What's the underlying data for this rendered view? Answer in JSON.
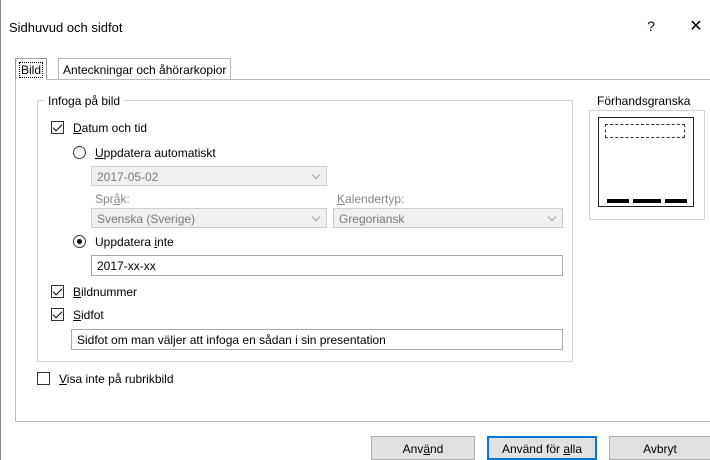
{
  "window": {
    "title": "Sidhuvud och sidfot",
    "help_label": "?",
    "close_label": "✕"
  },
  "tabs": [
    {
      "label": "Bild",
      "active": true
    },
    {
      "label": "Anteckningar och åhörarkopior",
      "active": false
    }
  ],
  "include_group": {
    "legend": "Infoga på bild",
    "date_time": {
      "label_pre": "",
      "label_u": "D",
      "label_post": "atum och tid",
      "checked": true
    },
    "auto_update": {
      "label_u": "U",
      "label_post": "ppdatera automatiskt",
      "selected": false,
      "date_value": "2017-05-02",
      "language_label_pre": "Spr",
      "language_label_u": "å",
      "language_label_post": "k:",
      "language_value": "Svenska (Sverige)",
      "calendar_label_u": "K",
      "calendar_label_post": "alendertyp:",
      "calendar_value": "Gregoriansk"
    },
    "fixed": {
      "label_pre": "Uppdatera ",
      "label_u": "i",
      "label_post": "nte",
      "selected": true,
      "value": "2017-xx-xx"
    },
    "slide_number": {
      "label_u": "B",
      "label_post": "ildnummer",
      "checked": true
    },
    "footer": {
      "label_u": "S",
      "label_post": "idfot",
      "checked": true,
      "value": "Sidfot om man väljer att infoga en sådan i sin presentation"
    }
  },
  "dont_show_title": {
    "label_u": "V",
    "label_post": "isa inte på rubrikbild",
    "checked": false
  },
  "preview": {
    "label": "Förhandsgranska"
  },
  "buttons": {
    "apply_pre": "Anv",
    "apply_u": "ä",
    "apply_post": "nd",
    "apply_all_pre": "Använd för ",
    "apply_all_u": "a",
    "apply_all_post": "lla",
    "cancel": "Avbryt"
  }
}
